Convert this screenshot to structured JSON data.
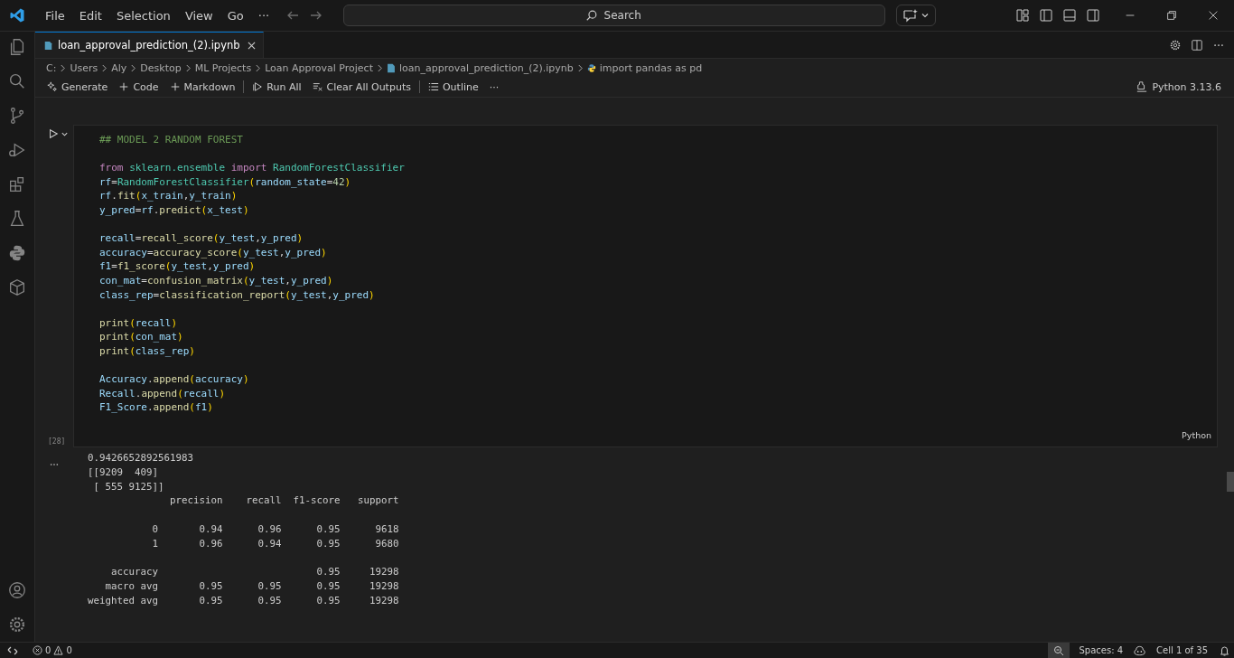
{
  "menu": [
    "File",
    "Edit",
    "Selection",
    "View",
    "Go",
    "···"
  ],
  "search": {
    "placeholder": "Search"
  },
  "tabs": [
    {
      "label": "loan_approval_prediction_(2).ipynb",
      "selected": true
    }
  ],
  "breadcrumb": [
    {
      "label": "C:",
      "kind": "folder"
    },
    {
      "label": "Users",
      "kind": "folder"
    },
    {
      "label": "Aly",
      "kind": "folder"
    },
    {
      "label": "Desktop",
      "kind": "folder"
    },
    {
      "label": "ML Projects",
      "kind": "folder"
    },
    {
      "label": "Loan Approval Project",
      "kind": "folder"
    },
    {
      "label": "loan_approval_prediction_(2).ipynb",
      "kind": "notebook"
    },
    {
      "label": "import pandas as pd",
      "kind": "cell"
    }
  ],
  "toolbar": [
    {
      "label": "Generate",
      "kind": "sparkle"
    },
    {
      "label": "Code",
      "kind": "plus"
    },
    {
      "label": "Markdown",
      "kind": "plus"
    },
    {
      "label": "Run All",
      "kind": "run",
      "divider": true
    },
    {
      "label": "Clear All Outputs",
      "kind": "clear"
    },
    {
      "label": "Outline",
      "kind": "list",
      "divider": true
    },
    {
      "label": "···",
      "kind": "more"
    }
  ],
  "kernel": "Python 3.13.6",
  "cell": {
    "execution_count": "[28]",
    "language": "Python",
    "blocks": [
      [
        [
          {
            "kind": "c",
            "text": "## MODEL 2 RANDOM FOREST"
          }
        ]
      ],
      [
        [
          {
            "kind": "k",
            "text": "from "
          },
          {
            "kind": "t",
            "text": "sklearn.ensemble "
          },
          {
            "kind": "k",
            "text": "import "
          },
          {
            "kind": "t",
            "text": "RandomForestClassifier"
          }
        ],
        [
          {
            "kind": "v",
            "text": "rf"
          },
          {
            "kind": "o",
            "text": "="
          },
          {
            "kind": "t",
            "text": "RandomForestClassifier"
          },
          {
            "kind": "p",
            "text": "("
          },
          {
            "kind": "v",
            "text": "random_state"
          },
          {
            "kind": "o",
            "text": "="
          },
          {
            "kind": "n",
            "text": "42"
          },
          {
            "kind": "p",
            "text": ")"
          }
        ],
        [
          {
            "kind": "v",
            "text": "rf"
          },
          {
            "kind": "o",
            "text": "."
          },
          {
            "kind": "f",
            "text": "fit"
          },
          {
            "kind": "p",
            "text": "("
          },
          {
            "kind": "v",
            "text": "x_train"
          },
          {
            "kind": "o",
            "text": ","
          },
          {
            "kind": "v",
            "text": "y_train"
          },
          {
            "kind": "p",
            "text": ")"
          }
        ],
        [
          {
            "kind": "v",
            "text": "y_pred"
          },
          {
            "kind": "o",
            "text": "="
          },
          {
            "kind": "v",
            "text": "rf"
          },
          {
            "kind": "o",
            "text": "."
          },
          {
            "kind": "f",
            "text": "predict"
          },
          {
            "kind": "p",
            "text": "("
          },
          {
            "kind": "v",
            "text": "x_test"
          },
          {
            "kind": "p",
            "text": ")"
          }
        ]
      ],
      [
        [
          {
            "kind": "v",
            "text": "recall"
          },
          {
            "kind": "o",
            "text": "="
          },
          {
            "kind": "f",
            "text": "recall_score"
          },
          {
            "kind": "p",
            "text": "("
          },
          {
            "kind": "v",
            "text": "y_test"
          },
          {
            "kind": "o",
            "text": ","
          },
          {
            "kind": "v",
            "text": "y_pred"
          },
          {
            "kind": "p",
            "text": ")"
          }
        ],
        [
          {
            "kind": "v",
            "text": "accuracy"
          },
          {
            "kind": "o",
            "text": "="
          },
          {
            "kind": "f",
            "text": "accuracy_score"
          },
          {
            "kind": "p",
            "text": "("
          },
          {
            "kind": "v",
            "text": "y_test"
          },
          {
            "kind": "o",
            "text": ","
          },
          {
            "kind": "v",
            "text": "y_pred"
          },
          {
            "kind": "p",
            "text": ")"
          }
        ],
        [
          {
            "kind": "v",
            "text": "f1"
          },
          {
            "kind": "o",
            "text": "="
          },
          {
            "kind": "f",
            "text": "f1_score"
          },
          {
            "kind": "p",
            "text": "("
          },
          {
            "kind": "v",
            "text": "y_test"
          },
          {
            "kind": "o",
            "text": ","
          },
          {
            "kind": "v",
            "text": "y_pred"
          },
          {
            "kind": "p",
            "text": ")"
          }
        ],
        [
          {
            "kind": "v",
            "text": "con_mat"
          },
          {
            "kind": "o",
            "text": "="
          },
          {
            "kind": "f",
            "text": "confusion_matrix"
          },
          {
            "kind": "p",
            "text": "("
          },
          {
            "kind": "v",
            "text": "y_test"
          },
          {
            "kind": "o",
            "text": ","
          },
          {
            "kind": "v",
            "text": "y_pred"
          },
          {
            "kind": "p",
            "text": ")"
          }
        ],
        [
          {
            "kind": "v",
            "text": "class_rep"
          },
          {
            "kind": "o",
            "text": "="
          },
          {
            "kind": "f",
            "text": "classification_report"
          },
          {
            "kind": "p",
            "text": "("
          },
          {
            "kind": "v",
            "text": "y_test"
          },
          {
            "kind": "o",
            "text": ","
          },
          {
            "kind": "v",
            "text": "y_pred"
          },
          {
            "kind": "p",
            "text": ")"
          }
        ]
      ],
      [
        [
          {
            "kind": "f",
            "text": "print"
          },
          {
            "kind": "p",
            "text": "("
          },
          {
            "kind": "v",
            "text": "recall"
          },
          {
            "kind": "p",
            "text": ")"
          }
        ],
        [
          {
            "kind": "f",
            "text": "print"
          },
          {
            "kind": "p",
            "text": "("
          },
          {
            "kind": "v",
            "text": "con_mat"
          },
          {
            "kind": "p",
            "text": ")"
          }
        ],
        [
          {
            "kind": "f",
            "text": "print"
          },
          {
            "kind": "p",
            "text": "("
          },
          {
            "kind": "v",
            "text": "class_rep"
          },
          {
            "kind": "p",
            "text": ")"
          }
        ]
      ],
      [
        [
          {
            "kind": "v",
            "text": "Accuracy"
          },
          {
            "kind": "o",
            "text": "."
          },
          {
            "kind": "f",
            "text": "append"
          },
          {
            "kind": "p",
            "text": "("
          },
          {
            "kind": "v",
            "text": "accuracy"
          },
          {
            "kind": "p",
            "text": ")"
          }
        ],
        [
          {
            "kind": "v",
            "text": "Recall"
          },
          {
            "kind": "o",
            "text": "."
          },
          {
            "kind": "f",
            "text": "append"
          },
          {
            "kind": "p",
            "text": "("
          },
          {
            "kind": "v",
            "text": "recall"
          },
          {
            "kind": "p",
            "text": ")"
          }
        ],
        [
          {
            "kind": "v",
            "text": "F1_Score"
          },
          {
            "kind": "o",
            "text": "."
          },
          {
            "kind": "f",
            "text": "append"
          },
          {
            "kind": "p",
            "text": "("
          },
          {
            "kind": "v",
            "text": "f1"
          },
          {
            "kind": "p",
            "text": ")"
          }
        ]
      ]
    ]
  },
  "output": [
    [
      "0.9426652892561983",
      "[[9209  409]",
      " [ 555 9125]]",
      "              precision    recall  f1-score   support"
    ],
    [
      "           0       0.94      0.96      0.95      9618",
      "           1       0.96      0.94      0.95      9680"
    ],
    [
      "    accuracy                           0.95     19298",
      "   macro avg       0.95      0.95      0.95     19298",
      "weighted avg       0.95      0.95      0.95     19298"
    ]
  ],
  "status": {
    "errors": "0",
    "warnings": "0",
    "spaces": "Spaces: 4",
    "cell": "Cell 1 of 35"
  }
}
